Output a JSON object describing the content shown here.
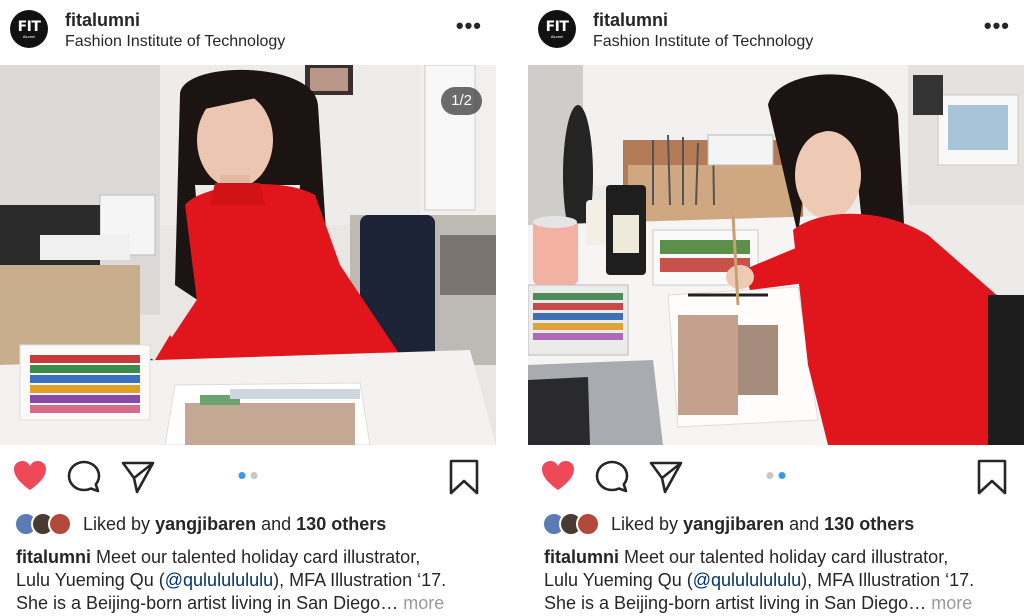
{
  "account": {
    "avatar_text": "FIT",
    "avatar_sub": "Alumni",
    "username": "fitalumni",
    "location": "Fashion Institute of Technology"
  },
  "icons": {
    "more": "more-dots-icon",
    "like": "heart-filled-icon",
    "comment": "comment-bubble-icon",
    "share": "paper-plane-icon",
    "save": "bookmark-icon"
  },
  "colors": {
    "like_red": "#ed4956",
    "active_dot": "#3897f0",
    "handle_blue": "#003569",
    "sweater_red": "#e0161c"
  },
  "posts": [
    {
      "counter": "1/2",
      "active_slide": 0,
      "likes": {
        "prefix": "Liked by",
        "user": "yangjibaren",
        "conj": "and",
        "others": "130 others"
      },
      "caption": {
        "user": "fitalumni",
        "line1": "Meet our talented holiday card illustrator,",
        "line2a": "Lulu Yueming Qu (",
        "handle": "@qulululululu",
        "line2b": "), MFA Illustration ‘17.",
        "line3": "She is a Beijing-born artist living in San Diego…",
        "more": "more"
      }
    },
    {
      "counter": "",
      "active_slide": 1,
      "likes": {
        "prefix": "Liked by",
        "user": "yangjibaren",
        "conj": "and",
        "others": "130 others"
      },
      "caption": {
        "user": "fitalumni",
        "line1": "Meet our talented holiday card illustrator,",
        "line2a": "Lulu Yueming Qu (",
        "handle": "@qulululululu",
        "line2b": "), MFA Illustration ‘17.",
        "line3": "She is a Beijing-born artist living in San Diego…",
        "more": "more"
      }
    }
  ]
}
